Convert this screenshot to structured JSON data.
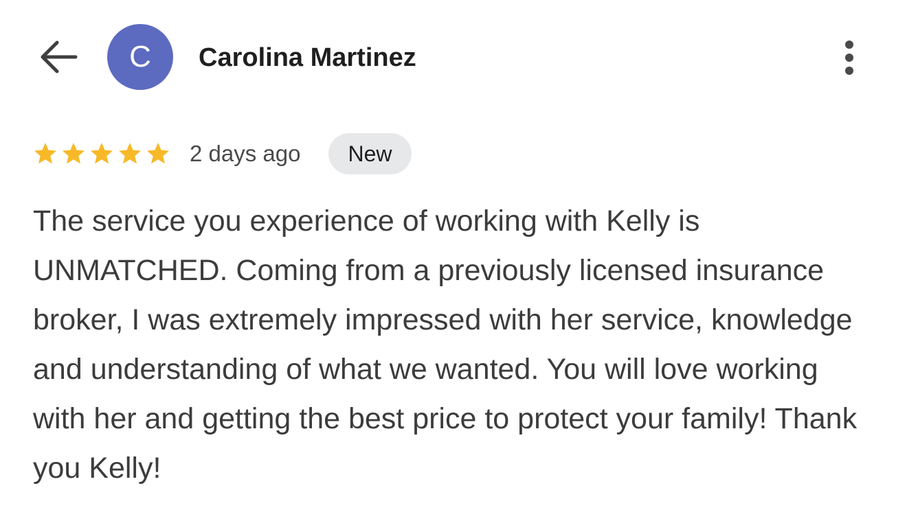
{
  "header": {
    "back_icon": "arrow-left-icon",
    "avatar_letter": "C",
    "avatar_color": "#5c6bc0",
    "author_name": "Carolina Martinez",
    "more_icon": "more-vert-icon"
  },
  "review": {
    "rating": 5,
    "max_rating": 5,
    "star_color": "#f7b928",
    "star_icon": "star-icon",
    "date": "2 days ago",
    "badge": "New",
    "text": "The service you experience of working with Kelly is UNMATCHED. Coming from a previously licensed insurance broker, I was extremely impressed with her service, knowledge and understanding of what we wanted. You will love working with her and getting the best price to protect your family! Thank you Kelly!"
  }
}
